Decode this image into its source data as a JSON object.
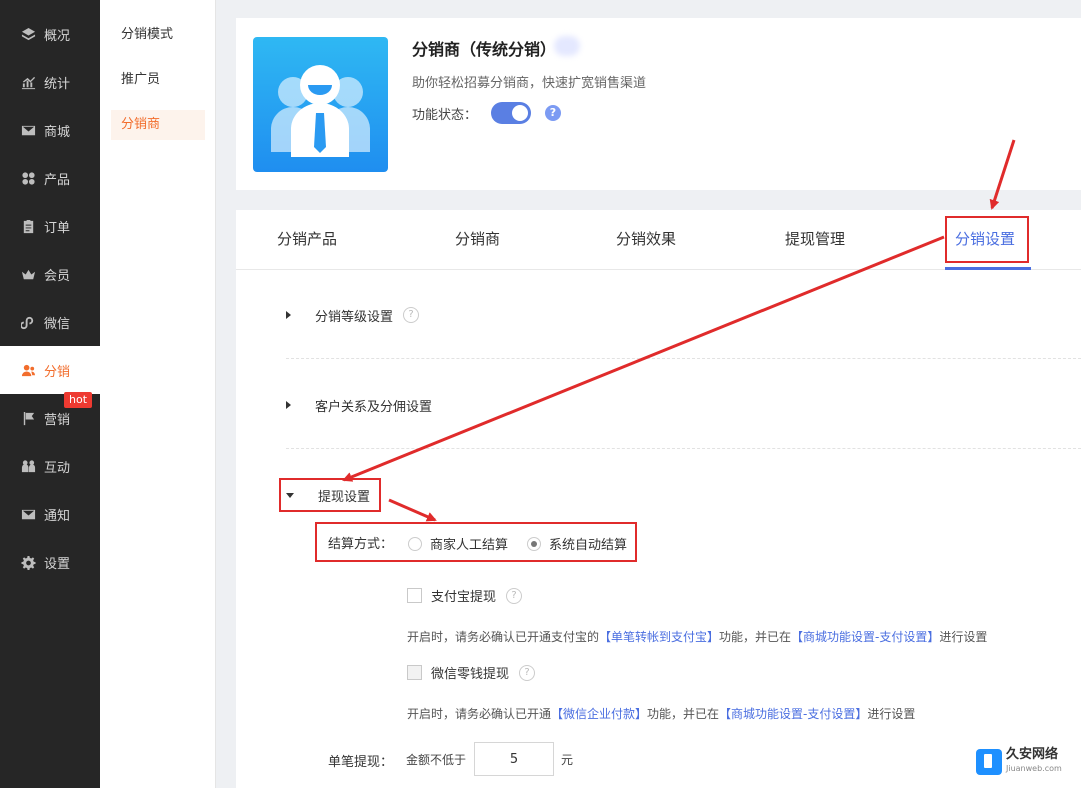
{
  "nav": {
    "items": [
      {
        "label": "概况",
        "icon": "layers-icon"
      },
      {
        "label": "统计",
        "icon": "chart-icon"
      },
      {
        "label": "商城",
        "icon": "mail-icon"
      },
      {
        "label": "产品",
        "icon": "grid-icon"
      },
      {
        "label": "订单",
        "icon": "clipboard-icon"
      },
      {
        "label": "会员",
        "icon": "crown-icon"
      },
      {
        "label": "微信",
        "icon": "link-icon"
      },
      {
        "label": "分销",
        "icon": "user-icon",
        "active": true
      },
      {
        "label": "营销",
        "icon": "flag-icon"
      },
      {
        "label": "互动",
        "icon": "people-icon"
      },
      {
        "label": "通知",
        "icon": "envelope-icon"
      },
      {
        "label": "设置",
        "icon": "gear-icon"
      }
    ],
    "hot_badge": "hot"
  },
  "subnav": {
    "items": [
      "分销模式",
      "推广员",
      "分销商"
    ],
    "active": "分销商"
  },
  "header": {
    "title": "分销商（传统分销）",
    "description": "助你轻松招募分销商，快速扩宽销售渠道",
    "status_label": "功能状态：",
    "status_on": true,
    "help": "?"
  },
  "tabs": [
    "分销产品",
    "分销商",
    "分销效果",
    "提现管理",
    "分销设置"
  ],
  "active_tab": "分销设置",
  "sections": {
    "level": "分销等级设置",
    "relation": "客户关系及分佣设置",
    "withdraw": "提现设置"
  },
  "withdraw": {
    "settle_label": "结算方式：",
    "options": [
      "商家人工结算",
      "系统自动结算"
    ],
    "selected": "系统自动结算",
    "alipay": {
      "label": "支付宝提现",
      "hint_pre": "开启时，请务必确认已开通支付宝的",
      "hint_link1": "【单笔转帐到支付宝】",
      "hint_mid": "功能，并已在",
      "hint_link2": "【商城功能设置-支付设置】",
      "hint_post": "进行设置"
    },
    "wechat": {
      "label": "微信零钱提现",
      "hint_pre": "开启时，请务必确认已开通",
      "hint_link1": "【微信企业付款】",
      "hint_mid": "功能，并已在",
      "hint_link2": "【商城功能设置-支付设置】",
      "hint_post": "进行设置"
    },
    "min_label": "单笔提现：",
    "min_pre": "金额不低于",
    "min_value": "5",
    "min_unit": "元"
  },
  "watermark": {
    "name": "久安网络",
    "site": "Jiuanweb.com"
  },
  "colors": {
    "accent": "#4a6ee0",
    "active_nav": "#f26d2c",
    "annotation": "#e02b2b"
  }
}
